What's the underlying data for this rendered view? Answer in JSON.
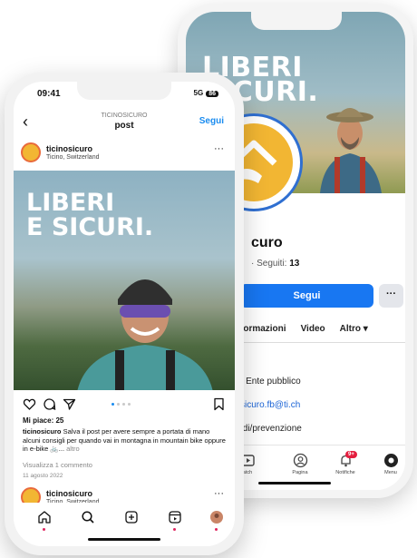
{
  "back_phone": {
    "cover_title": "LIBERI\nSICURI.",
    "page_name": "curo",
    "following_prefix": "· Seguiti: ",
    "following_count": "13",
    "follow_button": "Segui",
    "more_button": "···",
    "tabs": [
      "formazioni",
      "Video",
      "Altro ▾"
    ],
    "info_lines": [
      "· Ente pubblico",
      "sicuro.fb@ti.ch",
      "/di/prevenzione"
    ],
    "bottom_nav": [
      {
        "label": "atch",
        "icon": "video-icon"
      },
      {
        "label": "Pagina",
        "icon": "profile-icon"
      },
      {
        "label": "Notifiche",
        "icon": "bell-icon",
        "badge": "9+"
      },
      {
        "label": "Menu",
        "icon": "menu-avatar-icon"
      }
    ]
  },
  "front_phone": {
    "status": {
      "time": "09:41",
      "network": "5G",
      "battery": "86"
    },
    "header": {
      "account": "TICINOSICURO",
      "title": "post",
      "follow": "Segui"
    },
    "post": {
      "username": "ticinosicuro",
      "location": "Ticino, Switzerland",
      "image_title": "LIBERI\nE SICURI.",
      "likes": "Mi piace: 25",
      "caption_user": "ticinosicuro",
      "caption_text": " Salva il post per avere sempre a portata di mano alcuni consigli per quando vai in montagna in mountain bike oppure in e-bike 🚲... ",
      "caption_more": "altro",
      "comments": "Visualizza 1 commento",
      "date": "11 agosto 2022"
    },
    "next_post": {
      "username": "ticinosicuro",
      "location": "Ticino, Switzerland"
    },
    "nav_icons": [
      "home-icon",
      "search-icon",
      "add-post-icon",
      "reels-icon",
      "profile-avatar-icon"
    ]
  },
  "colors": {
    "facebook_blue": "#1877f2",
    "instagram_blue": "#1a8cf0",
    "brand_yellow": "#f2b633"
  }
}
